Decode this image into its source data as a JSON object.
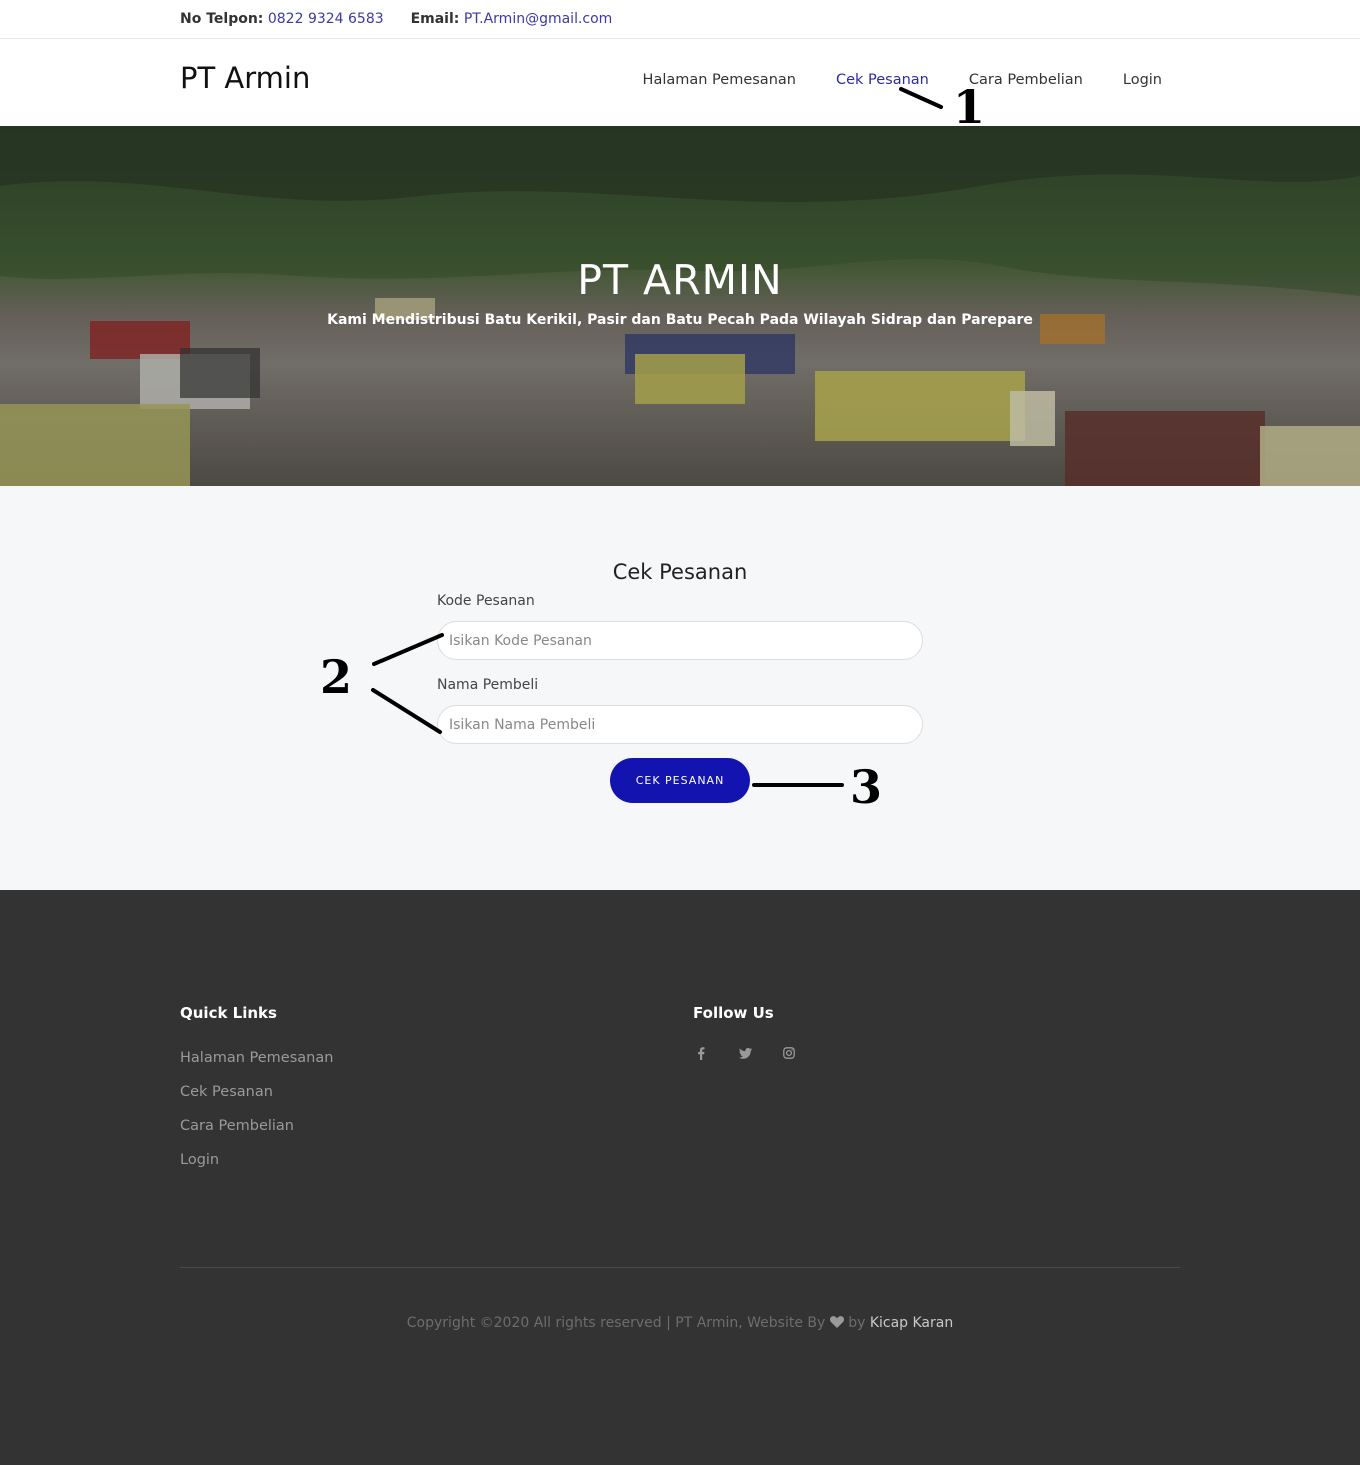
{
  "topbar": {
    "phone_label": "No Telpon:",
    "phone_value": "0822 9324 6583",
    "email_label": "Email:",
    "email_value": "PT.Armin@gmail.com"
  },
  "navbar": {
    "brand": "PT Armin",
    "items": [
      {
        "label": "Halaman Pemesanan",
        "active": false
      },
      {
        "label": "Cek Pesanan",
        "active": true
      },
      {
        "label": "Cara Pembelian",
        "active": false
      },
      {
        "label": "Login",
        "active": false
      }
    ]
  },
  "hero": {
    "title": "PT ARMIN",
    "subtitle": "Kami Mendistribusi Batu Kerikil, Pasir dan Batu Pecah Pada Wilayah Sidrap dan Parepare"
  },
  "form": {
    "title": "Cek Pesanan",
    "kode_label": "Kode Pesanan",
    "kode_placeholder": "Isikan Kode Pesanan",
    "nama_label": "Nama Pembeli",
    "nama_placeholder": "Isikan Nama Pembeli",
    "submit_label": "CEK PESANAN"
  },
  "annotations": {
    "one": "1",
    "two": "2",
    "three": "3"
  },
  "footer": {
    "quick_links_title": "Quick Links",
    "quick_links": [
      "Halaman Pemesanan",
      "Cek Pesanan",
      "Cara Pembelian",
      "Login"
    ],
    "follow_title": "Follow Us",
    "social_icons": [
      "facebook-icon",
      "twitter-icon",
      "instagram-icon"
    ],
    "copyright_prefix": "Copyright ©2020 All rights reserved | PT Armin, Website By",
    "copyright_by": "by",
    "copyright_author": "Kicap Karan"
  },
  "colors": {
    "accent": "#1313b0",
    "link": "#3b3ba3",
    "footer_bg": "#333333",
    "section_bg": "#f6f7f9"
  }
}
